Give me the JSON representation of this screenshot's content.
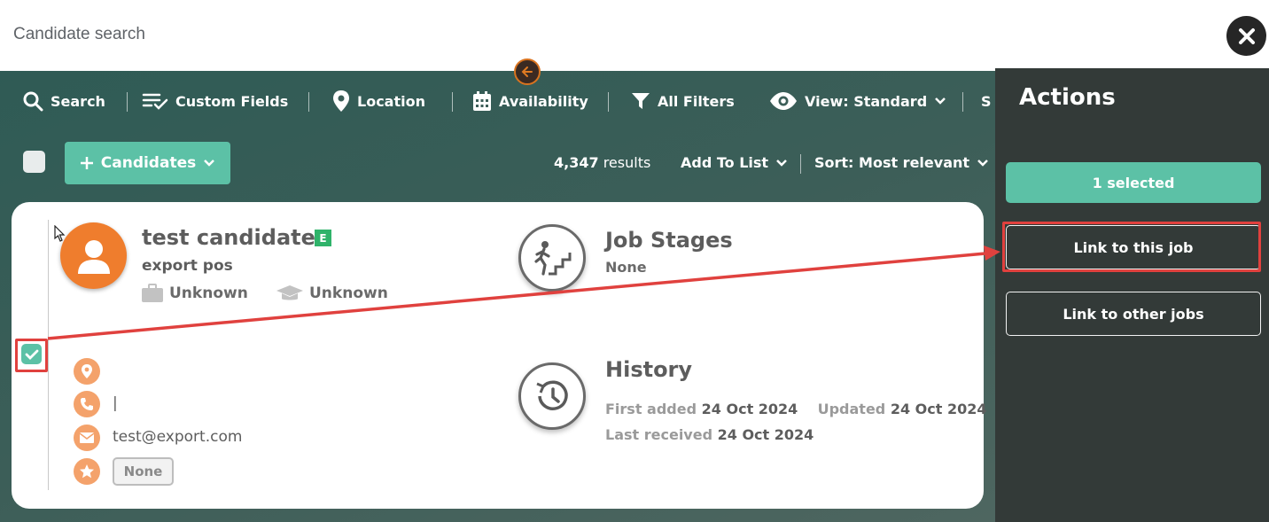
{
  "header": {
    "title": "Candidate search"
  },
  "toolbar": {
    "search": "Search",
    "custom_fields": "Custom Fields",
    "location": "Location",
    "availability": "Availability",
    "all_filters": "All Filters",
    "view": "View: Standard",
    "overflow": "S"
  },
  "list_bar": {
    "candidates_button": "Candidates",
    "results_count": "4,347",
    "results_label": "results",
    "add_to_list": "Add To List",
    "sort": "Sort: Most relevant"
  },
  "candidate": {
    "name": "test candidate",
    "badge": "E",
    "position": "export pos",
    "employment": "Unknown",
    "education": "Unknown",
    "phone": "|",
    "email": "test@export.com",
    "rating_tag": "None",
    "selected": true
  },
  "job_stages": {
    "title": "Job Stages",
    "value": "None"
  },
  "history": {
    "title": "History",
    "first_added_label": "First added",
    "first_added": "24 Oct 2024",
    "updated_label": "Updated",
    "updated": "24 Oct 2024",
    "last_received_label": "Last received",
    "last_received": "24 Oct 2024"
  },
  "actions_panel": {
    "title": "Actions",
    "selected_label": "1 selected",
    "link_this_job": "Link to this job",
    "link_other_jobs": "Link to other jobs"
  },
  "colors": {
    "accent": "#5cc1a6",
    "orange": "#ef7d2d",
    "annotation": "#e0413e",
    "panel_bg": "#333a38"
  }
}
